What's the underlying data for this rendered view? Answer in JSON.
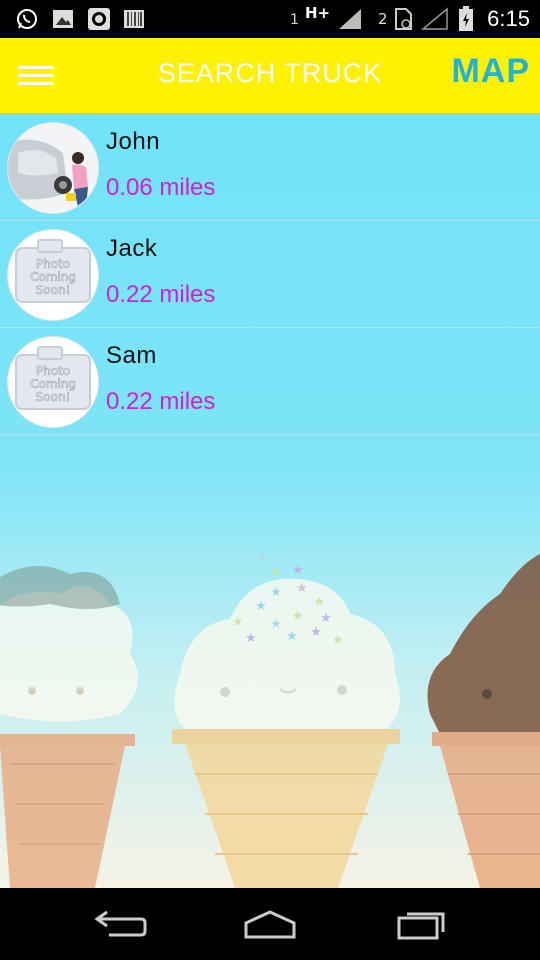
{
  "status_bar": {
    "time": "6:15",
    "sim1_label": "1",
    "sim1_network": "H+",
    "sim2_label": "2",
    "icons": [
      "whatsapp-icon",
      "image-icon",
      "circle-app-icon",
      "barcode-icon",
      "signal-icon",
      "sim-icon",
      "battery-icon"
    ]
  },
  "app_bar": {
    "title": "SEARCH TRUCK",
    "map_label": "MAP",
    "accent": "#fff200",
    "map_color": "#1fb3d9"
  },
  "trucks": [
    {
      "name": "John",
      "distance": "0.06 miles",
      "photo": "car-wash-photo"
    },
    {
      "name": "Jack",
      "distance": "0.22 miles",
      "photo": "photo-coming-soon"
    },
    {
      "name": "Sam",
      "distance": "0.22 miles",
      "photo": "photo-coming-soon"
    }
  ],
  "placeholder_photo": {
    "line1": "Photo",
    "line2": "Coming",
    "line3": "Soon!"
  },
  "distance_color": "#d21fd4",
  "nav_bar": {
    "icons": [
      "back-icon",
      "home-icon",
      "recent-apps-icon"
    ]
  }
}
